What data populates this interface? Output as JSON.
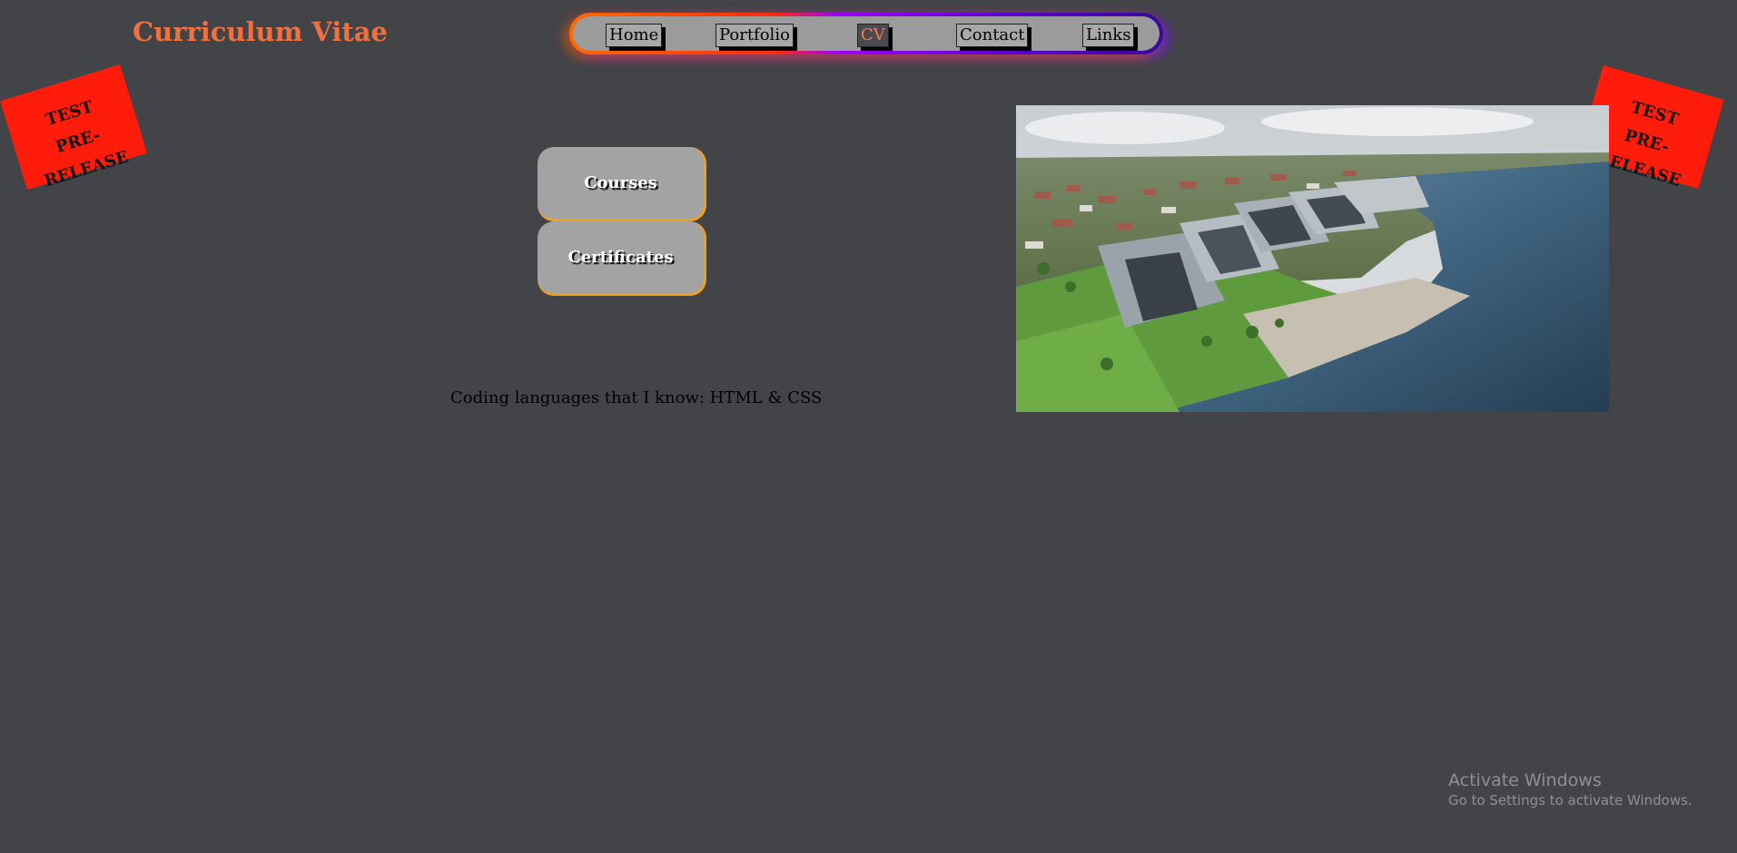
{
  "header": {
    "title": "Curriculum Vitae"
  },
  "nav": {
    "items": [
      {
        "label": "Home",
        "active": false
      },
      {
        "label": "Portfolio",
        "active": false
      },
      {
        "label": "CV",
        "active": true
      },
      {
        "label": "Contact",
        "active": false
      },
      {
        "label": "Links",
        "active": false
      }
    ]
  },
  "stamps": {
    "line1": "TEST",
    "line2": "PRE-RELEASE"
  },
  "sections": {
    "courses_label": "Courses",
    "certificates_label": "Certificates"
  },
  "main": {
    "coding_text": "Coding languages that I know: HTML & CSS"
  },
  "watermark": {
    "title": "Activate Windows",
    "subtitle": "Go to Settings to activate Windows."
  },
  "colors": {
    "background": "#434448",
    "title": "#f07040",
    "stamp": "#ff1c0a",
    "nav_gradient_start": "#ff6a00",
    "nav_gradient_end": "#3a0a9a",
    "button_border": "#f0a020"
  }
}
